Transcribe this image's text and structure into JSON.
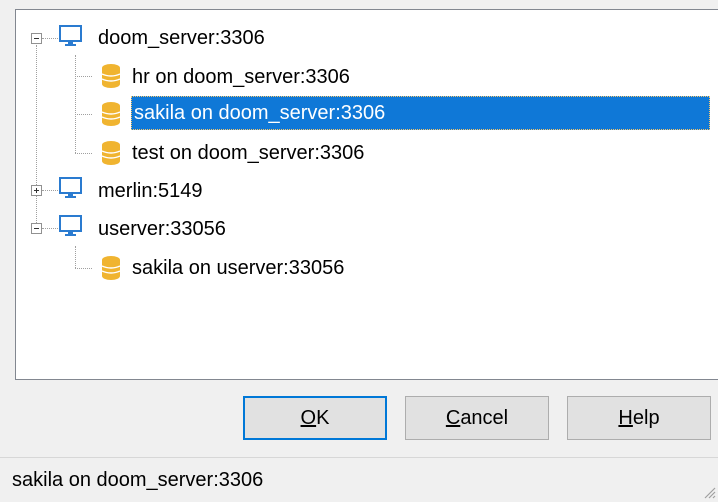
{
  "tree": {
    "servers": [
      {
        "label": "doom_server:3306",
        "expanded": true,
        "icon": "monitor-icon",
        "children": [
          {
            "label": "hr on doom_server:3306",
            "icon": "database-icon"
          },
          {
            "label": "sakila on doom_server:3306",
            "icon": "database-icon",
            "selected": true
          },
          {
            "label": "test on doom_server:3306",
            "icon": "database-icon"
          }
        ]
      },
      {
        "label": "merlin:5149",
        "expanded": false,
        "icon": "monitor-icon",
        "children": []
      },
      {
        "label": "userver:33056",
        "expanded": true,
        "icon": "monitor-icon",
        "children": [
          {
            "label": "sakila on userver:33056",
            "icon": "database-icon"
          }
        ]
      }
    ]
  },
  "buttons": {
    "ok": {
      "mnemonic": "O",
      "rest": "K"
    },
    "cancel": {
      "mnemonic": "C",
      "rest": "ancel"
    },
    "help": {
      "mnemonic": "H",
      "rest": "elp"
    }
  },
  "status": {
    "text": "sakila on doom_server:3306"
  },
  "colors": {
    "selection": "#0f78d7",
    "db_icon": "#f0b430",
    "monitor_icon": "#2a7bd0"
  }
}
